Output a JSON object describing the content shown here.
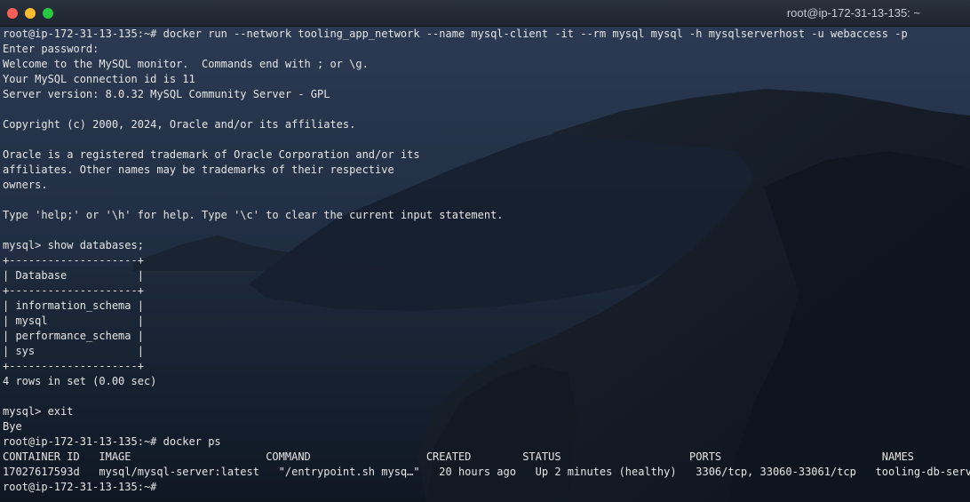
{
  "window": {
    "title": "root@ip-172-31-13-135: ~"
  },
  "terminal": {
    "lines": [
      "root@ip-172-31-13-135:~# docker run --network tooling_app_network --name mysql-client -it --rm mysql mysql -h mysqlserverhost -u webaccess -p",
      "Enter password:",
      "Welcome to the MySQL monitor.  Commands end with ; or \\g.",
      "Your MySQL connection id is 11",
      "Server version: 8.0.32 MySQL Community Server - GPL",
      "",
      "Copyright (c) 2000, 2024, Oracle and/or its affiliates.",
      "",
      "Oracle is a registered trademark of Oracle Corporation and/or its",
      "affiliates. Other names may be trademarks of their respective",
      "owners.",
      "",
      "Type 'help;' or '\\h' for help. Type '\\c' to clear the current input statement.",
      "",
      "mysql> show databases;",
      "+--------------------+",
      "| Database           |",
      "+--------------------+",
      "| information_schema |",
      "| mysql              |",
      "| performance_schema |",
      "| sys                |",
      "+--------------------+",
      "4 rows in set (0.00 sec)",
      "",
      "mysql> exit",
      "Bye",
      "root@ip-172-31-13-135:~# docker ps",
      "CONTAINER ID   IMAGE                     COMMAND                  CREATED        STATUS                    PORTS                         NAMES",
      "17027617593d   mysql/mysql-server:latest   \"/entrypoint.sh mysq…\"   20 hours ago   Up 2 minutes (healthy)   3306/tcp, 33060-33061/tcp   tooling-db-server",
      "root@ip-172-31-13-135:~#"
    ]
  },
  "colors": {
    "text": "#e6e6e6",
    "background": "#1b2636",
    "titlebar": "#1e2530",
    "close": "#fe5f57",
    "minimize": "#febc2e",
    "maximize": "#28c840"
  }
}
